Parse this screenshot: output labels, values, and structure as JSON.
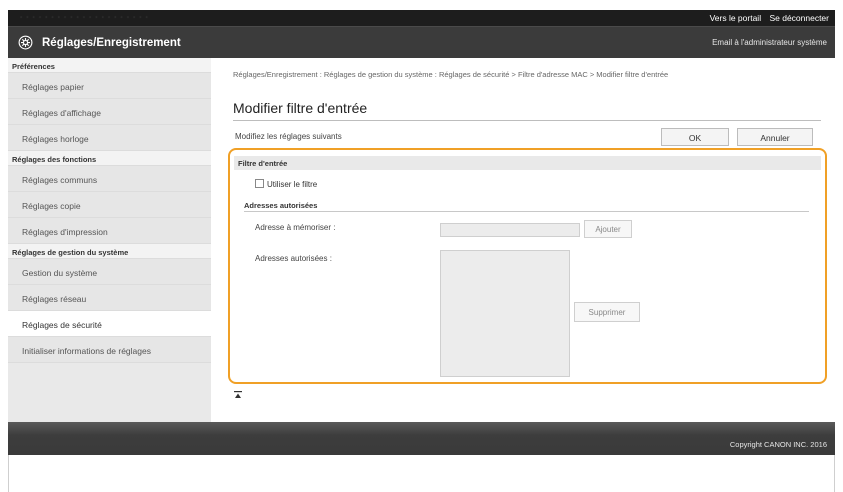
{
  "topbar": {
    "blurred_text": "· · · · ·  · · · · · · ·  · · · ·  · · · · ·",
    "portal_link": "Vers le portail",
    "logout_link": "Se déconnecter"
  },
  "header": {
    "title": "Réglages/Enregistrement",
    "email_link": "Email à l'administrateur système"
  },
  "sidebar": {
    "sections": [
      {
        "label": "Préférences",
        "items": [
          "Réglages papier",
          "Réglages d'affichage",
          "Réglages horloge"
        ]
      },
      {
        "label": "Réglages des fonctions",
        "items": [
          "Réglages communs",
          "Réglages copie",
          "Réglages d'impression"
        ]
      },
      {
        "label": "Réglages de gestion du système",
        "items": [
          "Gestion du système",
          "Réglages réseau",
          "Réglages de sécurité",
          "Initialiser informations de réglages"
        ]
      }
    ],
    "active_item": "Réglages de sécurité"
  },
  "main": {
    "breadcrumb": "Réglages/Enregistrement : Réglages de gestion du système : Réglages de sécurité > Filtre d'adresse MAC > Modifier filtre d'entrée",
    "page_title": "Modifier filtre d'entrée",
    "subtitle": "Modifiez les réglages suivants",
    "ok_label": "OK",
    "cancel_label": "Annuler",
    "section_title": "Filtre d'entrée",
    "use_filter_label": "Utiliser le filtre",
    "use_filter_checked": false,
    "subsection_title": "Adresses autorisées",
    "address_label": "Adresse à mémoriser :",
    "address_value": "",
    "add_label": "Ajouter",
    "allowed_label": "Adresses autorisées :",
    "allowed_addresses": [],
    "delete_label": "Supprimer"
  },
  "footer": {
    "copyright": "Copyright CANON INC. 2016"
  },
  "colors": {
    "highlight": "#f0a026",
    "header_bg": "#3b3b3b",
    "topbar_bg": "#1d1d1d"
  },
  "icons": [
    "gear-icon",
    "back-to-top-icon"
  ]
}
